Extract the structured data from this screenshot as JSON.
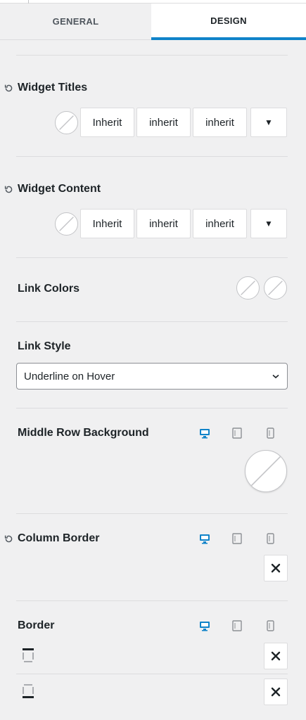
{
  "tabs": [
    {
      "label": "GENERAL",
      "active": false
    },
    {
      "label": "DESIGN",
      "active": true
    }
  ],
  "widget_titles": {
    "title": "Widget Titles",
    "font_family": "Inherit",
    "font_weight": "inherit",
    "text_transform": "inherit"
  },
  "widget_content": {
    "title": "Widget Content",
    "font_family": "Inherit",
    "font_weight": "inherit",
    "text_transform": "inherit"
  },
  "link_colors": {
    "title": "Link Colors"
  },
  "link_style": {
    "title": "Link Style",
    "selected": "Underline on Hover"
  },
  "middle_row_background": {
    "title": "Middle Row Background"
  },
  "column_border": {
    "title": "Column Border"
  },
  "border": {
    "title": "Border"
  },
  "colors": {
    "accent": "#1083c9",
    "text": "#1d2327",
    "muted": "#50575e",
    "border": "#dcdcde",
    "bg": "#f0f0f1"
  },
  "icons": {
    "reset": "reset-icon",
    "caret": "caret-down-icon",
    "chevron": "chevron-down-icon",
    "desktop": "desktop-icon",
    "tablet": "tablet-icon",
    "mobile": "mobile-icon",
    "close": "close-icon",
    "border_top": "border-top-icon",
    "border_bottom": "border-bottom-icon"
  }
}
